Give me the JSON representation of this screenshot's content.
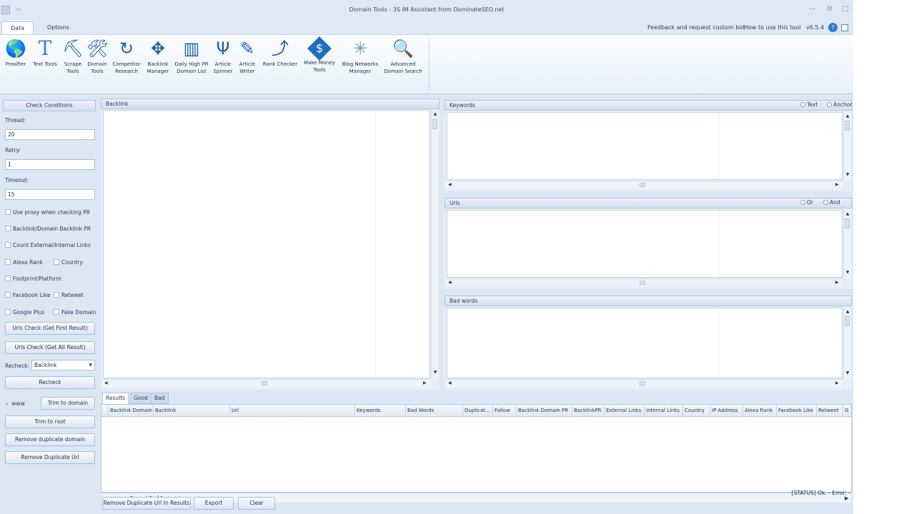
{
  "window": {
    "title": "Domain Tools - 3S IM Assistant from DominateSEO.net"
  },
  "ribbon_tabs": [
    {
      "label": "Data",
      "active": true
    },
    {
      "label": "Options",
      "active": false
    }
  ],
  "ribbon_links": {
    "feedback": "Feedback and request custom bot",
    "howto": "How to use this tool",
    "version": "v6.5.4"
  },
  "toolbar": [
    {
      "label": "Proxifier",
      "icon": "globe-icon",
      "glyph": "🌎"
    },
    {
      "label": "Text Tools",
      "icon": "text-t-icon",
      "glyph": "T"
    },
    {
      "label": "Scrape\nTools",
      "icon": "scrape-icon",
      "glyph": "⛏"
    },
    {
      "label": "Domain\nTools",
      "icon": "tools-icon",
      "glyph": "🛠"
    },
    {
      "label": "Competitor\nResearch",
      "icon": "competitor-icon",
      "glyph": "↻"
    },
    {
      "label": "Backlink\nManager",
      "icon": "backlink-icon",
      "glyph": "✥"
    },
    {
      "label": "Daily High PR\nDomain List",
      "icon": "book-icon",
      "glyph": "▥"
    },
    {
      "label": "Article\nSpinner",
      "icon": "spinner-icon",
      "glyph": "Ψ"
    },
    {
      "label": "Article\nWriter",
      "icon": "pen-icon",
      "glyph": "✎"
    },
    {
      "label": "Rank Checker",
      "icon": "rank-chart-icon",
      "glyph": "⤴"
    },
    {
      "label": "Make Money\nTools",
      "icon": "money-icon",
      "glyph": "$"
    },
    {
      "label": "Blog Networks\nManager",
      "icon": "network-icon",
      "glyph": "✳"
    },
    {
      "label": "Advanced\nDomain Search",
      "icon": "magnifier-icon",
      "glyph": "🔍"
    }
  ],
  "check_conditions": {
    "title": "Check Conditions",
    "thread_label": "Thread:",
    "thread_value": "20",
    "retry_label": "Retry:",
    "retry_value": "1",
    "timeout_label": "Timeout:",
    "timeout_value": "15",
    "options": [
      "Use proxy when checking PR",
      "Backlink/Domain Backlink PR",
      "Count External/Internal Links",
      "Alexa Rank",
      "Country",
      "Footprint/Platform",
      "Facebook Like",
      "Retweet",
      "Google Plus",
      "Fake Domain"
    ],
    "urls_check_first": "Urls Check (Get First Result)",
    "urls_check_all": "Urls Check (Get All Result)",
    "recheck_label": "Recheck:",
    "recheck_value": "Backlink",
    "recheck_button": "Recheck",
    "www_label": "www",
    "trim_domain": "Trim to domain",
    "trim_root": "Trim to root",
    "remove_dup_domain": "Remove duplicate domain",
    "remove_dup_url": "Remove Duplicate Url"
  },
  "backlink_panel": {
    "title": "Backlink"
  },
  "keywords_panel": {
    "title": "Keywords",
    "opt1": "Text",
    "opt2": "Anchor"
  },
  "urls_panel": {
    "title": "Urls",
    "opt1": "Or",
    "opt2": "And"
  },
  "badwords_panel": {
    "title": "Bad words"
  },
  "results": {
    "tabs": [
      "Results",
      "Good",
      "Bad"
    ],
    "columns": [
      "Backlink Domain",
      "Backlink",
      "Url",
      "Keywords",
      "Bad Words",
      "Duplicat...",
      "Follow",
      "Backlink Domain PR",
      "BacklinkPR",
      "External Links",
      "Internal Links",
      "Country",
      "IP Address",
      "Alexa Rank",
      "Facebook Like",
      "Retweet",
      "G"
    ],
    "record_text": "Record 0 of 0",
    "remove_dup_results": "Remove Duplicate Url In Results",
    "export": "Export",
    "clear": "Clear"
  },
  "status": {
    "text": "[STATUS] Ok. - Error: -"
  }
}
